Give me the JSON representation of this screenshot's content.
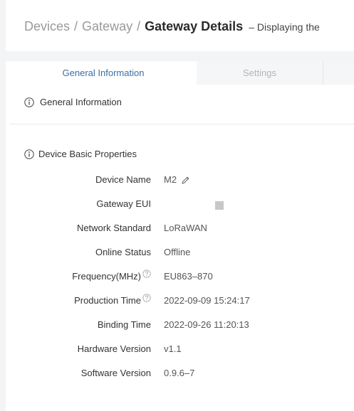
{
  "breadcrumb": {
    "devices": "Devices",
    "sep1": "/",
    "gateway": "Gateway",
    "sep2": "/",
    "current": "Gateway Details",
    "description": "– Displaying the"
  },
  "tabs": [
    {
      "label": "General Information",
      "active": true
    },
    {
      "label": "Settings",
      "active": false
    }
  ],
  "section": {
    "title": "General Information",
    "icon": "info-icon"
  },
  "properties": {
    "title": "Device Basic Properties",
    "icon": "info-icon",
    "rows": [
      {
        "label": "Device Name",
        "value": "M2",
        "editable": true
      },
      {
        "label": "Gateway EUI",
        "value": "",
        "masked": true
      },
      {
        "label": "Network Standard",
        "value": "LoRaWAN"
      },
      {
        "label": "Online Status",
        "value": "Offline"
      },
      {
        "label": "Frequency(MHz)",
        "value": "EU863–870",
        "help": true
      },
      {
        "label": "Production Time",
        "value": "2022-09-09 15:24:17",
        "help": true
      },
      {
        "label": "Binding Time",
        "value": "2022-09-26 11:20:13"
      },
      {
        "label": "Hardware Version",
        "value": "v1.1"
      },
      {
        "label": "Software Version",
        "value": "0.9.6–7"
      }
    ]
  },
  "colors": {
    "accent": "#3a6ea5",
    "muted": "#9a9a9a",
    "band": "#f3f4f6",
    "masked_block": "#c8c8c8"
  }
}
